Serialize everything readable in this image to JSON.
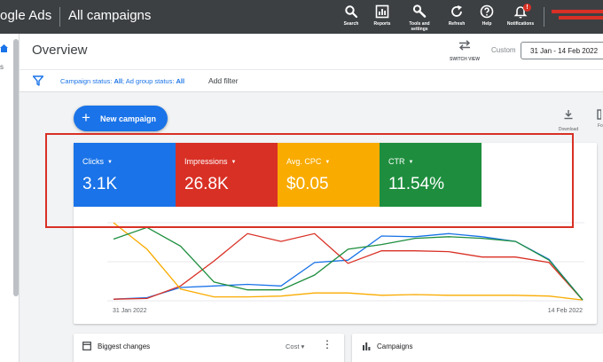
{
  "topbar": {
    "brand": "ogle Ads",
    "title": "All campaigns",
    "tools": [
      {
        "label": "Search",
        "icon": "search-icon"
      },
      {
        "label": "Reports",
        "icon": "reports-icon"
      },
      {
        "label": "Tools and settings",
        "icon": "wrench-icon"
      },
      {
        "label": "Refresh",
        "icon": "refresh-icon"
      },
      {
        "label": "Help",
        "icon": "help-icon"
      },
      {
        "label": "Notifications",
        "icon": "bell-icon",
        "badge": "!"
      }
    ]
  },
  "rail": {
    "mark": "s"
  },
  "overview": {
    "title": "Overview",
    "switch_view": "SWITCH VIEW",
    "custom_label": "Custom",
    "date_range": "31 Jan - 14 Feb 2022"
  },
  "filter": {
    "prefix1": "Campaign status: ",
    "value1": "All",
    "sep": "; Ad group status: ",
    "value2": "All",
    "add": "Add filter"
  },
  "actions": {
    "new_campaign": "New campaign",
    "plus": "+",
    "download": "Download",
    "more_label": "Fo"
  },
  "metrics": [
    {
      "label": "Clicks",
      "value": "3.1K",
      "color": "#1a73e8"
    },
    {
      "label": "Impressions",
      "value": "26.8K",
      "color": "#d93025"
    },
    {
      "label": "Avg. CPC",
      "value": "$0.05",
      "color": "#f9ab00"
    },
    {
      "label": "CTR",
      "value": "11.54%",
      "color": "#1e8e3e"
    }
  ],
  "chart_data": {
    "type": "line",
    "x_labels": [
      "31 Jan 2022",
      "14 Feb 2022"
    ],
    "n_points": 15,
    "grid": true,
    "series": [
      {
        "name": "Clicks",
        "color": "#1a73e8",
        "values": [
          0.02,
          0.04,
          0.17,
          0.19,
          0.21,
          0.19,
          0.49,
          0.52,
          0.83,
          0.82,
          0.86,
          0.82,
          0.76,
          0.53,
          0.01
        ]
      },
      {
        "name": "Impressions",
        "color": "#d93025",
        "values": [
          0.02,
          0.03,
          0.19,
          0.51,
          0.86,
          0.76,
          0.86,
          0.48,
          0.64,
          0.64,
          0.63,
          0.56,
          0.56,
          0.49,
          0.01
        ]
      },
      {
        "name": "Avg. CPC",
        "color": "#f9ab00",
        "values": [
          1.0,
          0.66,
          0.15,
          0.05,
          0.05,
          0.06,
          0.1,
          0.1,
          0.07,
          0.08,
          0.07,
          0.07,
          0.07,
          0.06,
          0.01
        ]
      },
      {
        "name": "CTR",
        "color": "#1e8e3e",
        "values": [
          0.79,
          0.94,
          0.7,
          0.24,
          0.14,
          0.14,
          0.33,
          0.66,
          0.72,
          0.8,
          0.82,
          0.8,
          0.76,
          0.52,
          0.01
        ]
      }
    ]
  },
  "bottom": {
    "biggest_changes": "Biggest changes",
    "cost": "Cost",
    "campaigns": "Campaigns"
  }
}
